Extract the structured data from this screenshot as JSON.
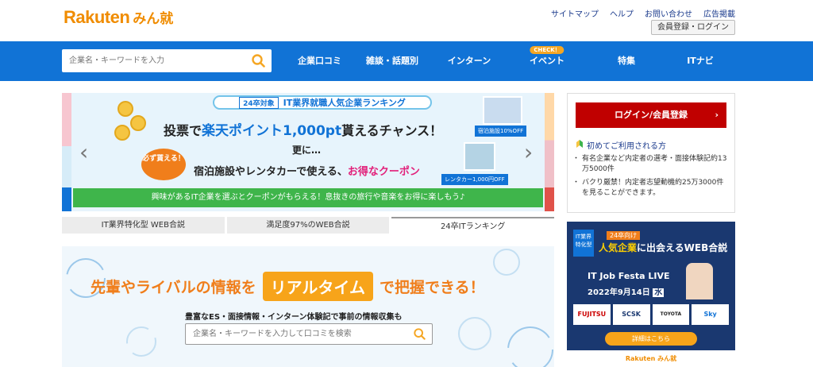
{
  "brand": {
    "rakuten": "Rakuten",
    "minshu": "みん就",
    "color": "#f08c00"
  },
  "util_links": [
    "サイトマップ",
    "ヘルプ",
    "お問い合わせ",
    "広告掲載"
  ],
  "login_button": "会員登録・ログイン",
  "nav": {
    "search_placeholder": "企業名・キーワードを入力",
    "items": [
      {
        "label": "企業口コミ",
        "badge": ""
      },
      {
        "label": "雑談・話題別",
        "badge": ""
      },
      {
        "label": "インターン",
        "badge": ""
      },
      {
        "label": "イベント",
        "badge": "CHECK！"
      },
      {
        "label": "特集",
        "badge": ""
      },
      {
        "label": "ITナビ",
        "badge": ""
      }
    ],
    "color": "#1173d6"
  },
  "banner": {
    "tag": "24卒対象",
    "heading": "IT業界就職人気企業ランキング",
    "main_a": "投票で",
    "main_b": "楽天ポイント1,000pt",
    "main_c": "貰えるチャンス！",
    "sub": "更に…",
    "circle": "必ず貰える！",
    "coupon_a": "宿泊施設やレンタカーで使える、",
    "coupon_b": "お得なクーポン",
    "hot1": "宿泊施設10%OFF",
    "hot2": "レンタカー1,000円OFF",
    "footer": "興味があるIT企業を選ぶとクーポンがもらえる！息抜きの旅行や音楽をお得に楽しもう♪"
  },
  "tabs": [
    {
      "label": "IT業界特化型 WEB合説",
      "active": false
    },
    {
      "label": "満足度97%のWEB合説",
      "active": false
    },
    {
      "label": "24卒ITランキング",
      "active": true
    }
  ],
  "hero": {
    "line1_a": "先輩やライバルの情報を",
    "line1_badge": "リアルタイム",
    "line1_b": "で把握できる！",
    "line2": "豊富なES・面接情報・インターン体験記で事前の情報収集も",
    "search_placeholder": "企業名・キーワードを入力して口コミを検索"
  },
  "side": {
    "login": "ログイン/会員登録",
    "first_use": "初めてご利用される方",
    "list": [
      "有名企業など内定者の選考・面接体験記約13万5000件",
      "バクり厳禁！内定者志望動機約25万3000件を見ることができます。"
    ]
  },
  "ad": {
    "tag": "IT業界特化型",
    "small": "24卒向け",
    "title_a": "人気企業",
    "title_b": "に出会えるWEB合説",
    "live": "IT Job Festa LIVE",
    "date": "2022年9月14日",
    "weekday": "水",
    "logos": [
      "FUJITSU",
      "SCSK",
      "TOYOTA SYSTEMS",
      "Sky"
    ],
    "button": "詳細はこちら",
    "footer": "Rakuten みん就"
  }
}
